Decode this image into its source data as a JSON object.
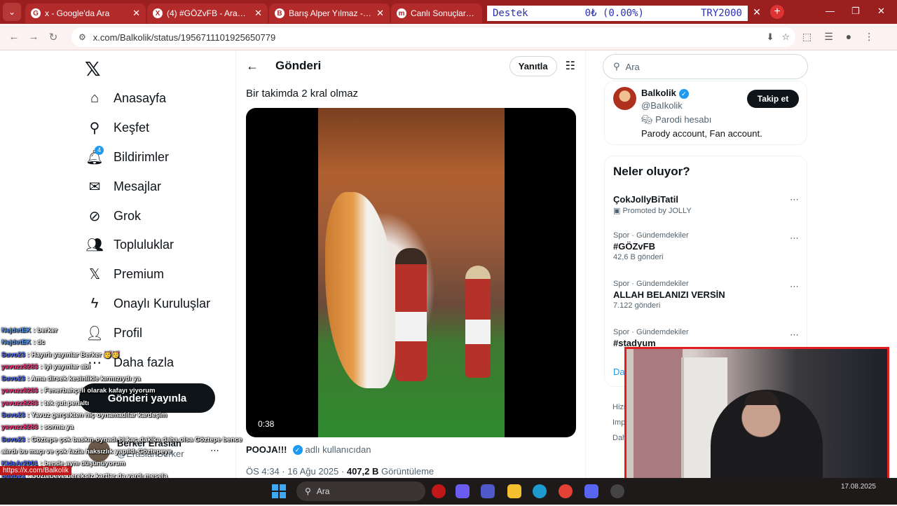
{
  "browser": {
    "tabs": [
      {
        "title": "x - Google'da Ara",
        "favicon": "G"
      },
      {
        "title": "(4) #GÖZvFB - Arama / X",
        "favicon": "X"
      },
      {
        "title": "Barış Alper Yılmaz - Oyunc",
        "favicon": "B"
      },
      {
        "title": "Canlı Sonuçlar - İddaa",
        "favicon": "m"
      }
    ],
    "overlay": {
      "left": "Destek",
      "middle": "0₺ (0.00%)",
      "right": "TRY2000"
    },
    "url": "x.com/Balkolik/status/1956711101925650779"
  },
  "nav": {
    "items": [
      {
        "label": "Anasayfa",
        "icon": "home-icon",
        "glyph": "⌂"
      },
      {
        "label": "Keşfet",
        "icon": "search-icon",
        "glyph": "⚲"
      },
      {
        "label": "Bildirimler",
        "icon": "bell-icon",
        "glyph": "🔔︎",
        "badge": "4"
      },
      {
        "label": "Mesajlar",
        "icon": "mail-icon",
        "glyph": "✉"
      },
      {
        "label": "Grok",
        "icon": "grok-icon",
        "glyph": "⊘"
      },
      {
        "label": "Topluluklar",
        "icon": "communities-icon",
        "glyph": "👥︎"
      },
      {
        "label": "Premium",
        "icon": "x-premium-icon",
        "glyph": "𝕏"
      },
      {
        "label": "Onaylı Kuruluşlar",
        "icon": "lightning-icon",
        "glyph": "ϟ"
      },
      {
        "label": "Profil",
        "icon": "person-icon",
        "glyph": "👤︎"
      },
      {
        "label": "Daha fazla",
        "icon": "more-circle-icon",
        "glyph": "⋯"
      }
    ],
    "post_button": "Gönderi yayınla",
    "account": {
      "name": "Berker Eraslan",
      "handle": "@EraslanBerker"
    }
  },
  "main": {
    "title": "Gönderi",
    "reply_label": "Yanıtla",
    "post_text": "Bir takimda 2 kral olmaz",
    "video_time": "0:38",
    "source_user": "POOJA!!!",
    "source_suffix": "adlı kullanıcıdan",
    "timestamp": "ÖS 4:34 · 16 Ağu 2025 ·",
    "views_count": "407,2 B",
    "views_label": "Görüntüleme"
  },
  "right": {
    "search_placeholder": "Ara",
    "profile": {
      "name": "Balkolik",
      "handle": "@BaIkolik",
      "parody_label": "Parodi hesabı",
      "bio": "Parody account, Fan account.",
      "follow_label": "Takip et"
    },
    "trends_title": "Neler oluyor?",
    "trends": [
      {
        "context": "",
        "name": "ÇokJollyBiTatil",
        "meta": "Promoted by JOLLY"
      },
      {
        "context": "Spor · Gündemdekiler",
        "name": "#GÖZvFB",
        "meta": "42,6 B gönderi"
      },
      {
        "context": "Spor · Gündemdekiler",
        "name": "ALLAH BELANIZI VERSİN",
        "meta": "7.122 gönderi"
      },
      {
        "context": "Spor · Gündemdekiler",
        "name": "#stadyum",
        "meta": ""
      }
    ],
    "show_more": "Da",
    "footer": [
      "Hizm",
      "Impr",
      "Dah"
    ]
  },
  "chat": [
    {
      "user": "NejdetEK",
      "msg": "berker",
      "color": "#5aa0ff"
    },
    {
      "user": "NejdetEK",
      "msg": "dc",
      "color": "#5aa0ff"
    },
    {
      "user": "Suvo23",
      "msg": "Hayırlı yayınlar Berker 🥳🥳",
      "color": "#4d6bff"
    },
    {
      "user": "yavuzz8283",
      "msg": "iyi yayınlar abi",
      "color": "#ff3b8a"
    },
    {
      "user": "Suvo23",
      "msg": "Ama dirsek kesinlikle kırmızıydı ya",
      "color": "#4d6bff"
    },
    {
      "user": "yavuzz8283",
      "msg": "Fenerbahçeli olarak kafayı yiyorum",
      "color": "#ff3b8a"
    },
    {
      "user": "yavuzz8283",
      "msg": "tek şut penaltı",
      "color": "#ff3b8a"
    },
    {
      "user": "Suvo23",
      "msg": "Yavuz gerçekten hiç oynamadılar kardeşim",
      "color": "#4d6bff"
    },
    {
      "user": "yavuzz8283",
      "msg": "sorma ya",
      "color": "#ff3b8a"
    },
    {
      "user": "Suvo23",
      "msg": "Göztepe çok baskın oynadı bi kaç dakika daha olsa Göztepe bence",
      "color": "#4d6bff"
    },
    {
      "user": "",
      "msg": "alırdı bu maçı ve çok fazla haksızlık yapıldı Göztepeye",
      "color": "#4d6bff"
    },
    {
      "user": "KidsAr2001",
      "msg": "bende aynı düşünüyorum",
      "color": "#4d6bff"
    },
    {
      "user": "Suvo23",
      "msg": "Göztepeye gereksiz kartlar da vardı mesela",
      "color": "#4d6bff"
    },
    {
      "user": "KidsAr2001",
      "msg": "yunus kesilmemeli",
      "color": "#4d6bff"
    },
    {
      "user": "yavuzz8283",
      "msg": "ya adamlar sane osimhen diyor biz kerem alamiyoz",
      "color": "#ff3b8a"
    }
  ],
  "chat_link": "https://x.com/Balkolik",
  "taskbar": {
    "search_placeholder": "Ara",
    "date": "17.08.2025"
  }
}
